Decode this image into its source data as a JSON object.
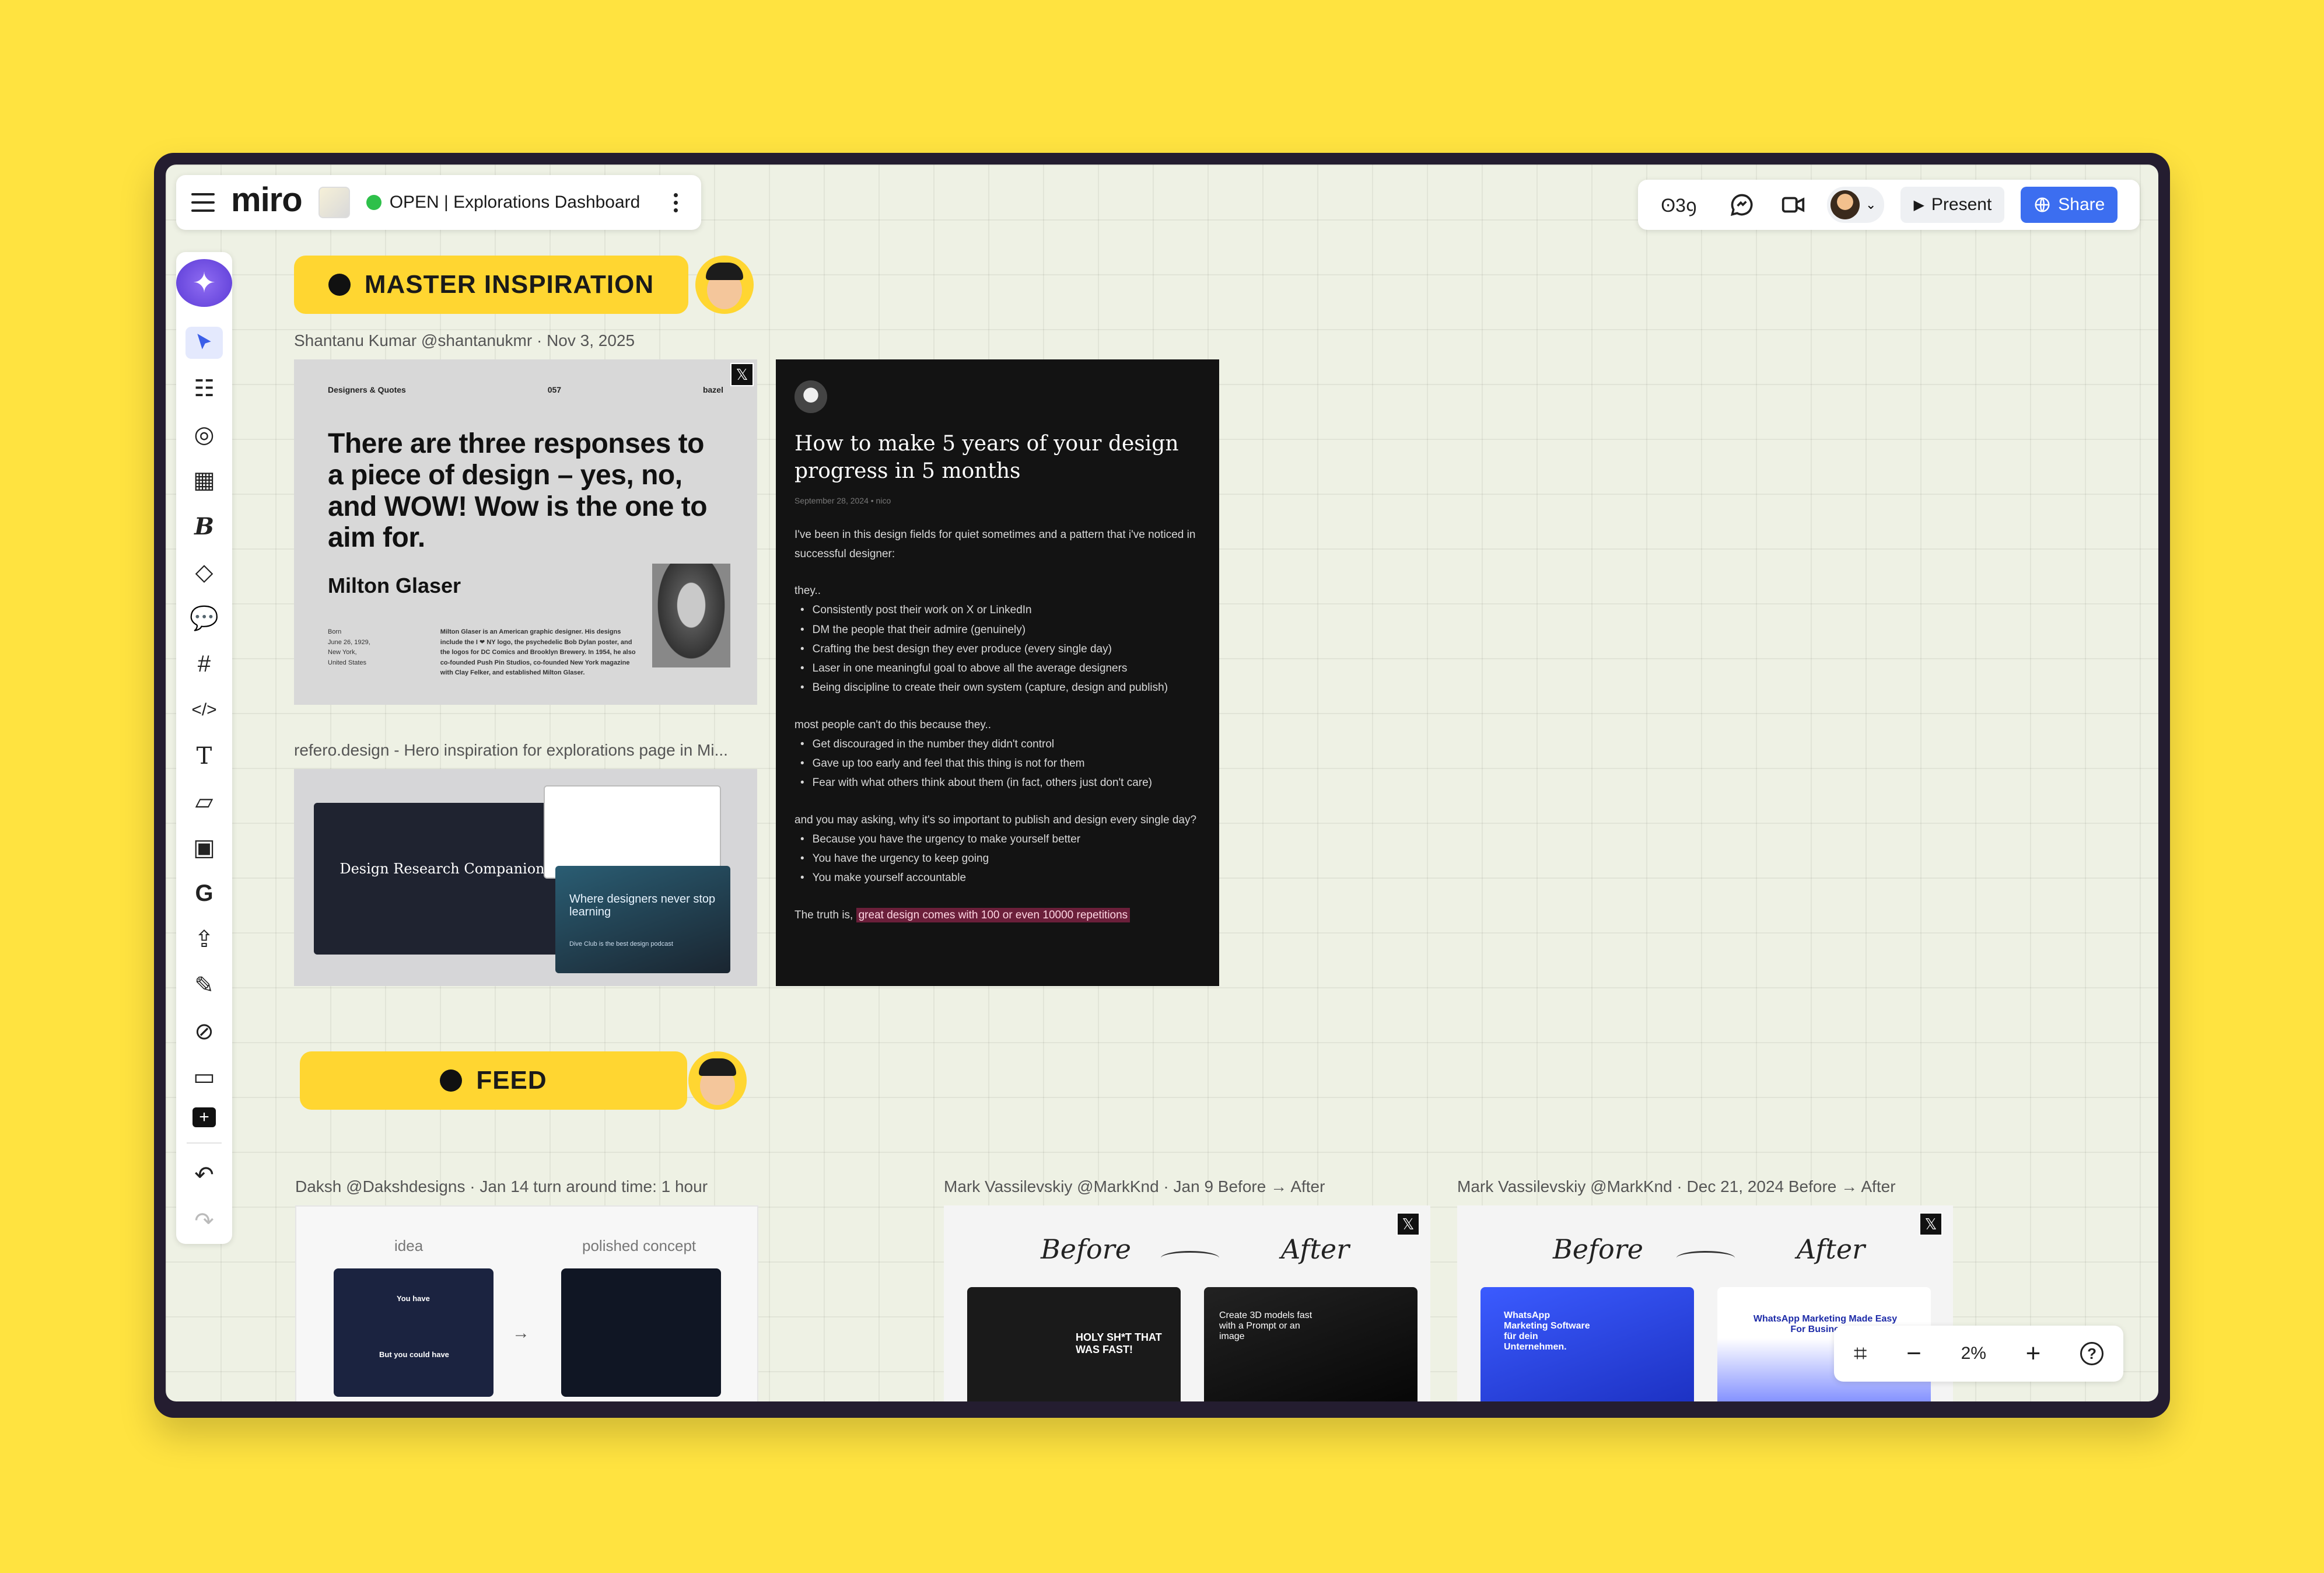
{
  "header": {
    "logo": "miro",
    "board_status": "OPEN",
    "board_name": "OPEN | Explorations Dashboard",
    "reactions_glyph": "ʘ3ꝯ",
    "present_label": "Present",
    "share_label": "Share"
  },
  "sections": {
    "master": {
      "title": "MASTER INSPIRATION"
    },
    "feed": {
      "title": "FEED"
    }
  },
  "cards": {
    "milton": {
      "caption": "Shantanu Kumar  @shantanukmr · Nov 3, 2025",
      "series": "Designers & Quotes",
      "number": "057",
      "brand": "bazel",
      "quote": "There are three responses to a piece of design – yes, no, and WOW! Wow is the one to aim for.",
      "author": "Milton Glaser",
      "born_label": "Born",
      "born_date": "June 26, 1929,",
      "born_place": "New York,",
      "born_country": "United States",
      "bio": "Milton Glaser is an American graphic designer. His designs include the I ❤ NY logo, the psychedelic Bob Dylan poster, and the logos for DC Comics and Brooklyn Brewery. In 1954, he also co-founded Push Pin Studios, co-founded New York magazine with Clay Felker, and established Milton Glaser."
    },
    "article": {
      "title": "How to make 5 years of your design progress in 5 months",
      "date": "September 28, 2024  •  nico",
      "intro": "I've been in this design fields for quiet sometimes and a pattern that i've noticed in successful designer:",
      "they": "they..",
      "list1": [
        "Consistently post their work on X or LinkedIn",
        "DM the people that their admire (genuinely)",
        "Crafting the best design they ever produce (every single day)",
        "Laser in one meaningful goal to above all the average designers",
        "Being discipline to create their own system (capture, design and publish)"
      ],
      "most": "most people can't do this because they..",
      "list2": [
        "Get discouraged in the number they didn't control",
        "Gave up too early and feel that this thing is not for them",
        "Fear with what others think about them (in fact, others just don't care)"
      ],
      "asking": "and you may asking, why it's so important to publish and design every single day?",
      "list3": [
        "Because you have the urgency to make yourself better",
        "You have the urgency to keep going",
        "You make yourself accountable"
      ],
      "truth_prefix": "The truth is, ",
      "truth_highlight": "great design comes with 100 or even 10000 repetitions"
    },
    "refero": {
      "caption": "refero.design - Hero inspiration for explorations page in Mi...",
      "dark_title": "Design Research Companion",
      "teal_title": "Where designers never stop learning",
      "teal_sub": "Dive Club is the best design podcast"
    },
    "daksh": {
      "caption": "Daksh  @Dakshdesigns · Jan 14   turn around time: 1 hour",
      "label_left": "idea",
      "label_right": "polished concept",
      "shot_text_1": "You have",
      "shot_text_2": "But you could have"
    },
    "mark1": {
      "caption": "Mark Vassilevskiy  @MarkKnd · Jan 9   Before → After",
      "before": "Before",
      "after": "After",
      "before_text": "HOLY SH*T THAT WAS FAST!",
      "after_text": "Create 3D models fast with a Prompt or an image"
    },
    "mark2": {
      "caption": "Mark Vassilevskiy  @MarkKnd · Dec 21, 2024   Before → After",
      "before": "Before",
      "after": "After",
      "before_text": "WhatsApp Marketing Software für dein Unternehmen.",
      "after_text": "WhatsApp Marketing Made Easy For Businesses"
    }
  },
  "zoom": {
    "level": "2%"
  },
  "icons": [
    "menu-icon",
    "chat-icon",
    "video-icon",
    "play-icon",
    "globe-icon",
    "sparkle-icon",
    "cursor-icon",
    "x-logo-icon",
    "undo-icon",
    "redo-icon",
    "help-icon"
  ]
}
